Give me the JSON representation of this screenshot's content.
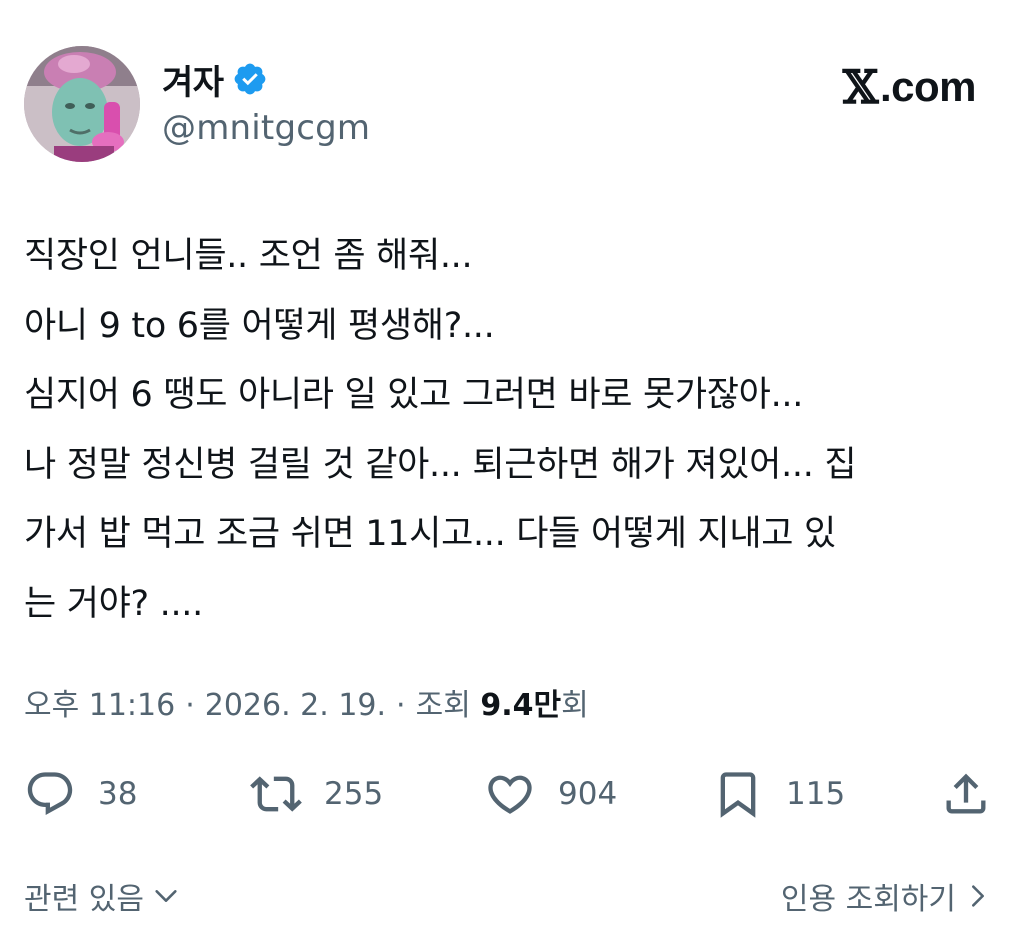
{
  "author": {
    "display_name": "겨자",
    "handle": "@mnitgcgm",
    "verified": true,
    "verified_color": "#1d9bf0"
  },
  "source": {
    "logo_mark": "𝕏",
    "logo_text": ".com"
  },
  "tweet": {
    "lines": [
      "직장인 언니들.. 조언 좀 해줘...",
      "아니 9 to 6를 어떻게 평생해?...",
      "심지어 6 땡도 아니라 일 있고 그러면 바로 못가잖아...",
      "나 정말 정신병 걸릴 것 같아... 퇴근하면 해가 져있어... 집",
      "가서 밥 먹고 조금 쉬면 11시고... 다들 어떻게 지내고 있",
      "는 거야? ...."
    ]
  },
  "meta": {
    "time": "오후 11:16",
    "separator": "·",
    "date": "2026. 2. 19.",
    "views_label": "조회",
    "views_value": "9.4만",
    "views_suffix": "회"
  },
  "actions": {
    "reply": {
      "icon": "reply-icon",
      "count": "38"
    },
    "retweet": {
      "icon": "retweet-icon",
      "count": "255"
    },
    "like": {
      "icon": "heart-icon",
      "count": "904"
    },
    "bookmark": {
      "icon": "bookmark-icon",
      "count": "115"
    },
    "share": {
      "icon": "share-icon"
    }
  },
  "footer": {
    "related_label": "관련 있음",
    "quotes_label": "인용 조회하기"
  },
  "colors": {
    "text_primary": "#0f1419",
    "text_secondary": "#536471",
    "verified_blue": "#1d9bf0"
  }
}
